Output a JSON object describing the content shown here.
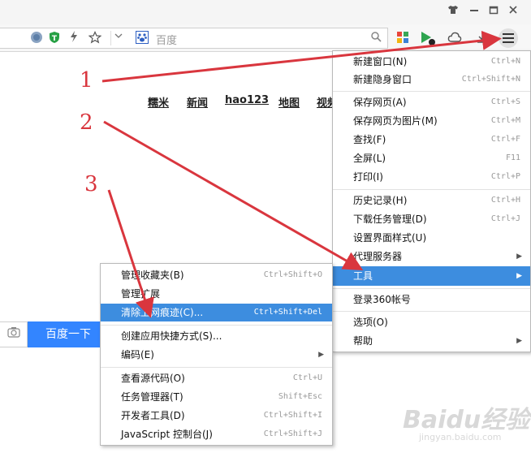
{
  "window": {
    "icons": [
      "shirt-icon",
      "minimize-icon",
      "restore-icon",
      "close-icon"
    ]
  },
  "toolbar": {
    "search_placeholder": "百度"
  },
  "page": {
    "nav_links": [
      "糯米",
      "新闻",
      "hao123",
      "地图",
      "视频"
    ],
    "search_button": "百度一下"
  },
  "main_menu": {
    "items": [
      {
        "label": "新建窗口(N)",
        "shortcut": "Ctrl+N"
      },
      {
        "label": "新建隐身窗口",
        "shortcut": "Ctrl+Shift+N"
      },
      {
        "label": "保存网页(A)",
        "shortcut": "Ctrl+S"
      },
      {
        "label": "保存网页为图片(M)",
        "shortcut": "Ctrl+M"
      },
      {
        "label": "查找(F)",
        "shortcut": "Ctrl+F"
      },
      {
        "label": "全屏(L)",
        "shortcut": "F11"
      },
      {
        "label": "打印(I)",
        "shortcut": "Ctrl+P"
      },
      {
        "label": "历史记录(H)",
        "shortcut": "Ctrl+H"
      },
      {
        "label": "下载任务管理(D)",
        "shortcut": "Ctrl+J"
      },
      {
        "label": "设置界面样式(U)",
        "shortcut": ""
      },
      {
        "label": "代理服务器",
        "shortcut": ""
      },
      {
        "label": "工具",
        "shortcut": ""
      },
      {
        "label": "登录360帐号",
        "shortcut": ""
      },
      {
        "label": "选项(O)",
        "shortcut": ""
      },
      {
        "label": "帮助",
        "shortcut": ""
      }
    ]
  },
  "tools_menu": {
    "items": [
      {
        "label": "管理收藏夹(B)",
        "shortcut": "Ctrl+Shift+O"
      },
      {
        "label": "管理扩展",
        "shortcut": ""
      },
      {
        "label": "清除上网痕迹(C)...",
        "shortcut": "Ctrl+Shift+Del"
      },
      {
        "label": "创建应用快捷方式(S)...",
        "shortcut": ""
      },
      {
        "label": "编码(E)",
        "shortcut": ""
      },
      {
        "label": "查看源代码(O)",
        "shortcut": "Ctrl+U"
      },
      {
        "label": "任务管理器(T)",
        "shortcut": "Shift+Esc"
      },
      {
        "label": "开发者工具(D)",
        "shortcut": "Ctrl+Shift+I"
      },
      {
        "label": "JavaScript 控制台(J)",
        "shortcut": "Ctrl+Shift+J"
      }
    ]
  },
  "annotations": [
    "1",
    "2",
    "3"
  ],
  "watermark": {
    "text": "Baidu经验",
    "sub": "jingyan.baidu.com"
  },
  "colors": {
    "highlight": "#3d8ddf",
    "search_button": "#3385ff",
    "arrow": "#d9363e"
  }
}
